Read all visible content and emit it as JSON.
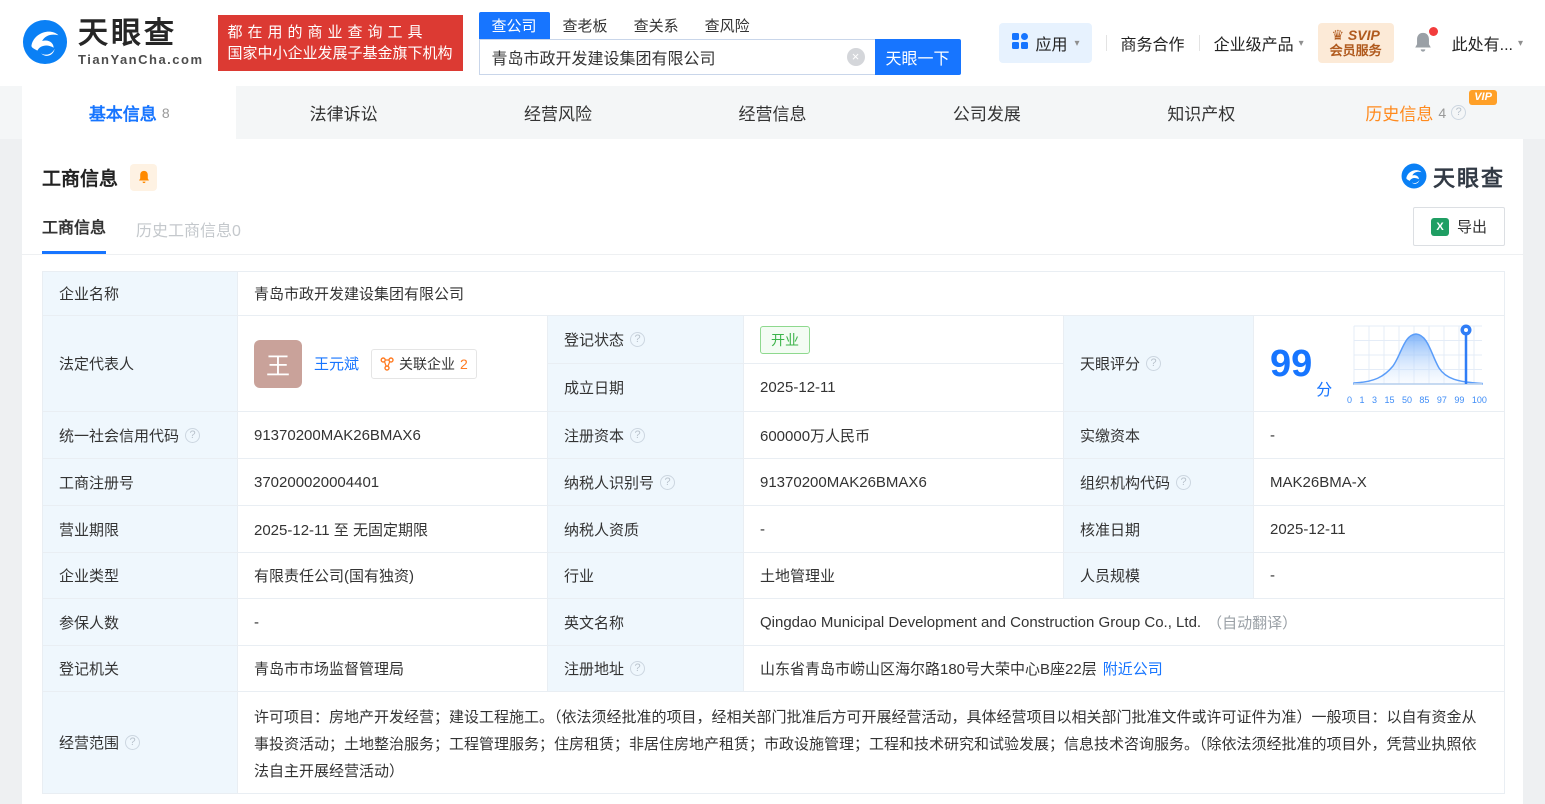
{
  "brand": {
    "name": "天眼查",
    "domain": "TianYanCha.com",
    "slogan_line1": "都在用的商业查询工具",
    "slogan_line2": "国家中小企业发展子基金旗下机构"
  },
  "search": {
    "tabs": [
      {
        "label": "查公司"
      },
      {
        "label": "查老板"
      },
      {
        "label": "查关系"
      },
      {
        "label": "查风险"
      }
    ],
    "value": "青岛市政开发建设集团有限公司",
    "button": "天眼一下"
  },
  "header_right": {
    "apps": "应用",
    "business_coop": "商务合作",
    "enterprise_products": "企业级产品",
    "svip_line1": "SVIP",
    "svip_line2": "会员服务",
    "user": "此处有..."
  },
  "nav_tabs": [
    {
      "label": "基本信息",
      "count": "8"
    },
    {
      "label": "法律诉讼",
      "count": ""
    },
    {
      "label": "经营风险",
      "count": ""
    },
    {
      "label": "经营信息",
      "count": ""
    },
    {
      "label": "公司发展",
      "count": ""
    },
    {
      "label": "知识产权",
      "count": ""
    },
    {
      "label": "历史信息",
      "count": "4",
      "vip": "VIP"
    }
  ],
  "section": {
    "title": "工商信息",
    "watermark": "天眼查",
    "subtab_active": "工商信息",
    "subtab_history": "历史工商信息",
    "subtab_history_count": "0",
    "export_label": "导出"
  },
  "fields": {
    "company_name": {
      "label": "企业名称",
      "value": "青岛市政开发建设集团有限公司"
    },
    "legal_rep": {
      "label": "法定代表人",
      "avatar": "王",
      "name": "王元斌",
      "related_label": "关联企业",
      "related_count": "2"
    },
    "reg_status": {
      "label": "登记状态",
      "value": "开业"
    },
    "establish_date": {
      "label": "成立日期",
      "value": "2025-12-11"
    },
    "tyc_score": {
      "label": "天眼评分",
      "score": "99",
      "unit": "分"
    },
    "credit_code": {
      "label": "统一社会信用代码",
      "value": "91370200MAK26BMAX6"
    },
    "reg_capital": {
      "label": "注册资本",
      "value": "600000万人民币"
    },
    "paid_capital": {
      "label": "实缴资本",
      "value": "-"
    },
    "reg_number": {
      "label": "工商注册号",
      "value": "370200020004401"
    },
    "taxpayer_id": {
      "label": "纳税人识别号",
      "value": "91370200MAK26BMAX6"
    },
    "org_code": {
      "label": "组织机构代码",
      "value": "MAK26BMA-X"
    },
    "business_term": {
      "label": "营业期限",
      "value": "2025-12-11 至 无固定期限"
    },
    "taxpayer_quality": {
      "label": "纳税人资质",
      "value": "-"
    },
    "approval_date": {
      "label": "核准日期",
      "value": "2025-12-11"
    },
    "company_type": {
      "label": "企业类型",
      "value": "有限责任公司(国有独资)"
    },
    "industry": {
      "label": "行业",
      "value": "土地管理业"
    },
    "staff_size": {
      "label": "人员规模",
      "value": "-"
    },
    "insured_count": {
      "label": "参保人数",
      "value": "-"
    },
    "english_name": {
      "label": "英文名称",
      "value": "Qingdao Municipal Development and Construction Group Co., Ltd.",
      "note": "（自动翻译）"
    },
    "reg_authority": {
      "label": "登记机关",
      "value": "青岛市市场监督管理局"
    },
    "reg_address": {
      "label": "注册地址",
      "value": "山东省青岛市崂山区海尔路180号大荣中心B座22层",
      "link": "附近公司"
    },
    "business_scope": {
      "label": "经营范围",
      "value": "许可项目：房地产开发经营；建设工程施工。（依法须经批准的项目，经相关部门批准后方可开展经营活动，具体经营项目以相关部门批准文件或许可证件为准）一般项目：以自有资金从事投资活动；土地整治服务；工程管理服务；住房租赁；非居住房地产租赁；市政设施管理；工程和技术研究和试验发展；信息技术咨询服务。（除依法须经批准的项目外，凭营业执照依法自主开展经营活动）"
    }
  },
  "score_chart": {
    "type": "area",
    "description": "score-distribution-bell-curve",
    "x_labels": [
      "0",
      "1",
      "3",
      "15",
      "50",
      "85",
      "97",
      "99",
      "100"
    ],
    "marker_value": 99,
    "curve_color": "#5b9df9",
    "marker_color": "#2f7df6"
  },
  "icons": {
    "caret": "▾",
    "clear": "×",
    "help": "?",
    "crown": "♛",
    "excel": "X"
  },
  "colors": {
    "primary_blue": "#1775ff",
    "brand_red": "#dc3a33",
    "vip_orange": "#ffa028",
    "status_green": "#3cb44a",
    "label_bg": "#eff7fd"
  }
}
